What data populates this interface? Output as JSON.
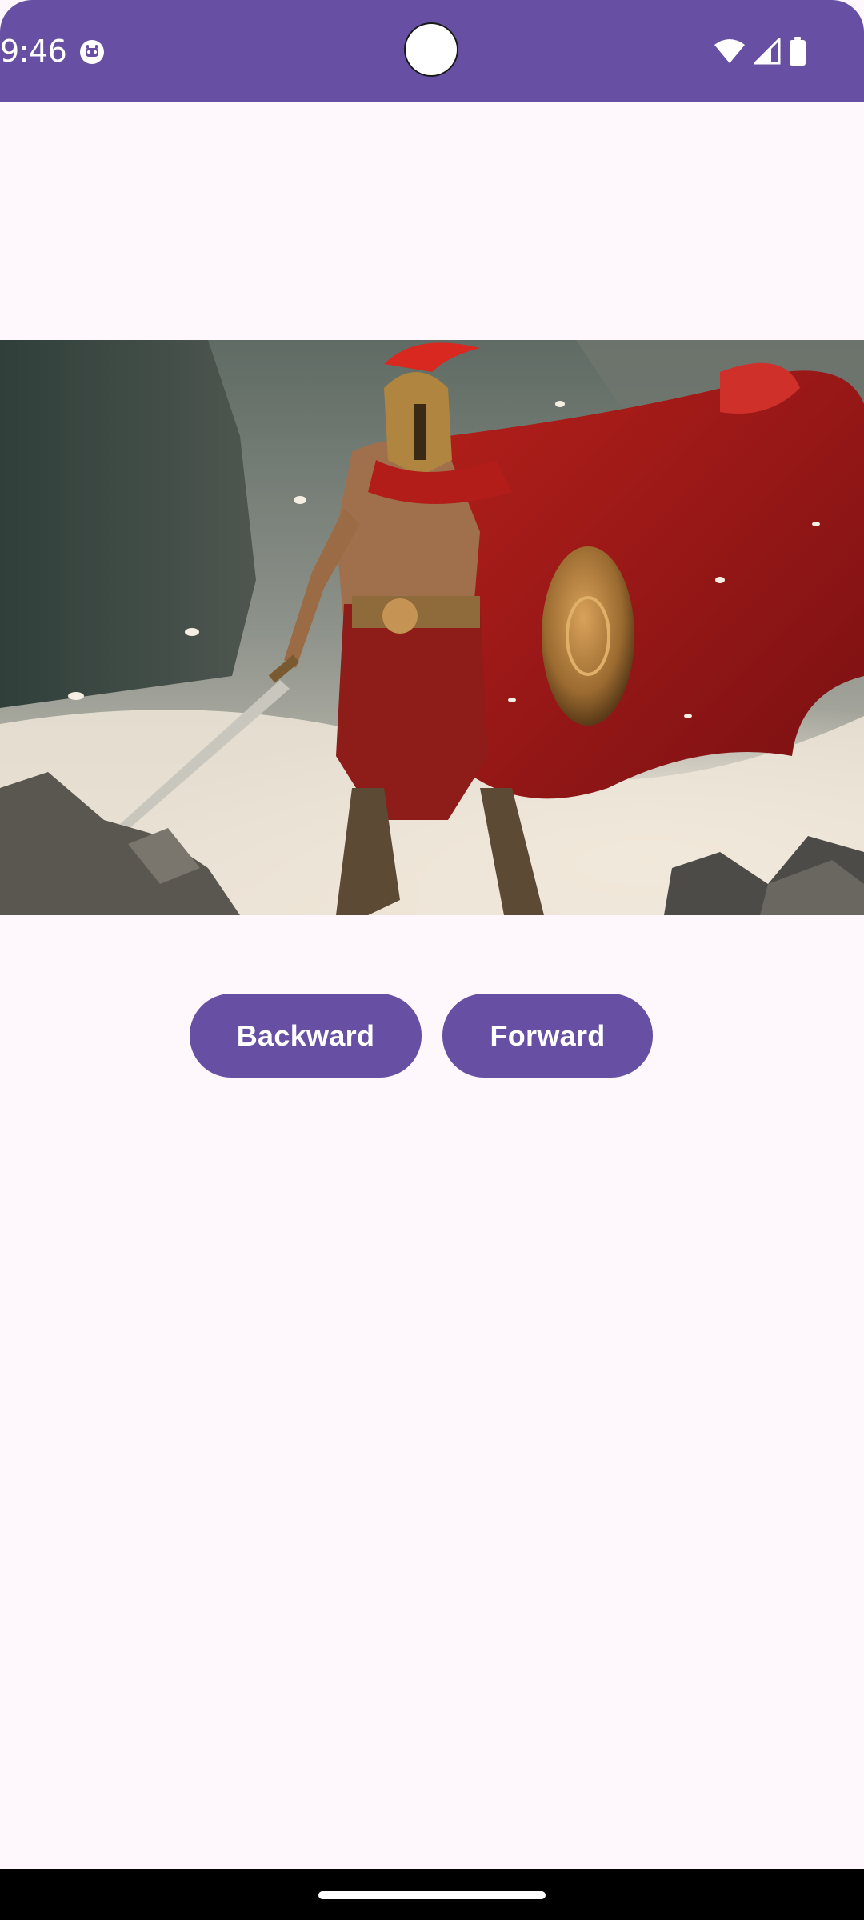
{
  "status_bar": {
    "time": "9:46",
    "background": "#6750a4",
    "icons": [
      "app-notification-icon",
      "wifi-icon",
      "cellular-signal-icon",
      "battery-icon"
    ]
  },
  "image": {
    "description_icon": "warrior-artwork-image"
  },
  "buttons": {
    "backward_label": "Backward",
    "forward_label": "Forward",
    "color": "#6750a4"
  },
  "nav_bar": {
    "indicator": "home-indicator"
  }
}
